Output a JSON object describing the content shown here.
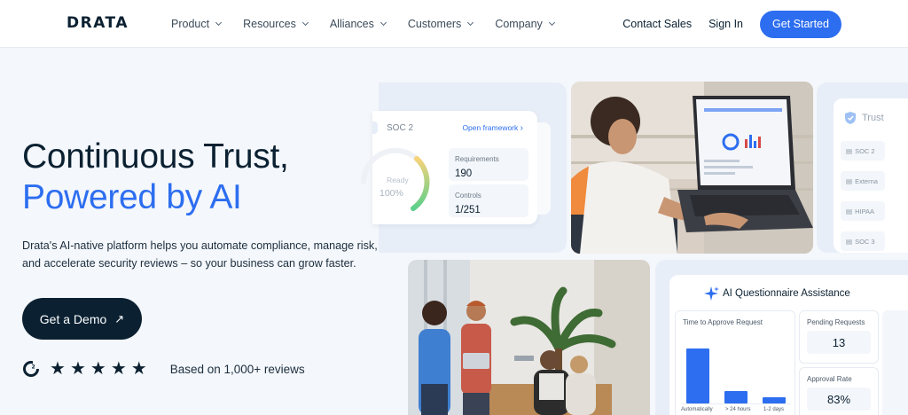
{
  "nav": {
    "logo": "DRATA",
    "menu": [
      "Product",
      "Resources",
      "Alliances",
      "Customers",
      "Company"
    ],
    "contact_sales": "Contact Sales",
    "sign_in": "Sign In",
    "get_started": "Get Started"
  },
  "hero": {
    "title_line1": "Continuous Trust,",
    "title_line2": "Powered by AI",
    "description": "Drata's AI-native platform helps you automate compliance, manage risk, and accelerate security reviews – so your business can grow faster.",
    "demo_button": "Get a Demo",
    "rating_stars": 5,
    "reviews_text": "Based on 1,000+ reviews"
  },
  "soc_card": {
    "title": "SOC 2",
    "link": "Open framework",
    "gauge_label": "Ready",
    "gauge_value": "100%",
    "requirements_label": "Requirements",
    "requirements_value": "190",
    "controls_label": "Controls",
    "controls_value": "1/251"
  },
  "trust_card": {
    "title": "Trust",
    "items": [
      "SOC 2",
      "Externa",
      "HIPAA",
      "SOC 3"
    ]
  },
  "ai_card": {
    "title": "AI Questionnaire Assistance",
    "chart_title": "Time to Approve Request",
    "bar_labels": [
      "Automatically",
      "> 24 hours",
      "1-2 days"
    ],
    "bar_values": [
      1.0,
      0.22,
      0.12
    ],
    "pending_label": "Pending Requests",
    "pending_value": "13",
    "approval_label": "Approval Rate",
    "approval_value": "83%"
  },
  "colors": {
    "navy": "#0b2132",
    "blue": "#2d6ef0",
    "page_bg": "#f4f7fb"
  }
}
